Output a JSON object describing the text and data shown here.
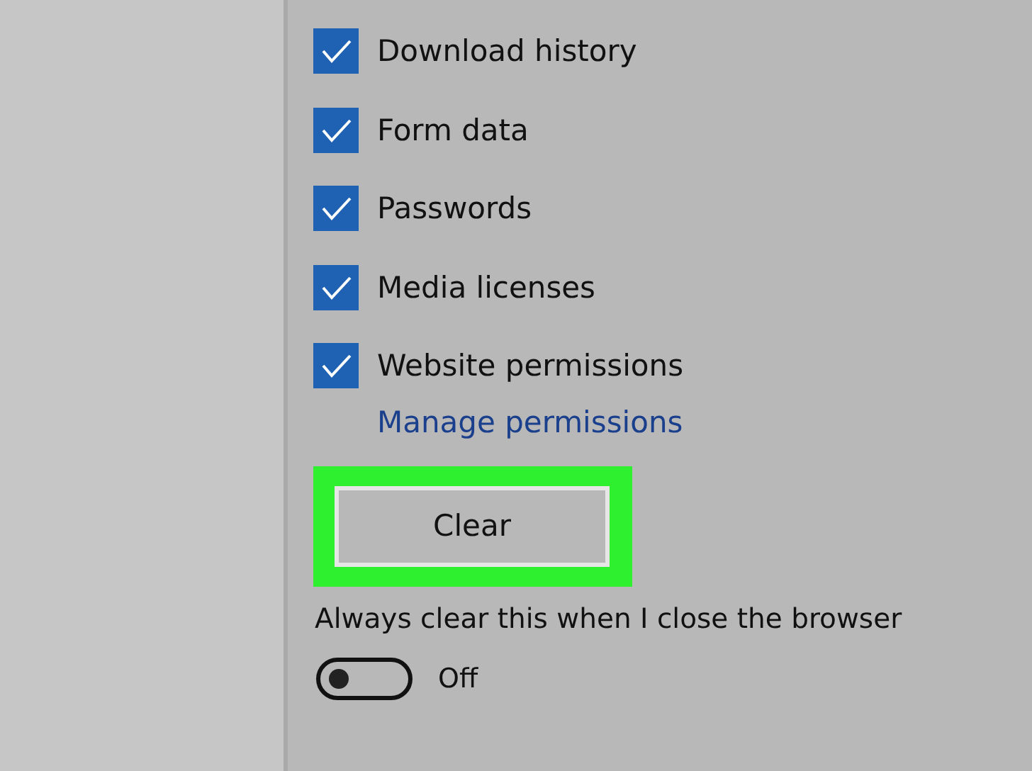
{
  "checkboxes": [
    {
      "label": "Download history",
      "checked": true
    },
    {
      "label": "Form data",
      "checked": true
    },
    {
      "label": "Passwords",
      "checked": true
    },
    {
      "label": "Media licenses",
      "checked": true
    },
    {
      "label": "Website permissions",
      "checked": true
    }
  ],
  "manage_link": "Manage permissions",
  "clear_button": {
    "label": "Clear",
    "highlighted": true
  },
  "always_clear": {
    "label": "Always clear this when I close the browser",
    "on": false,
    "state_text": "Off"
  }
}
